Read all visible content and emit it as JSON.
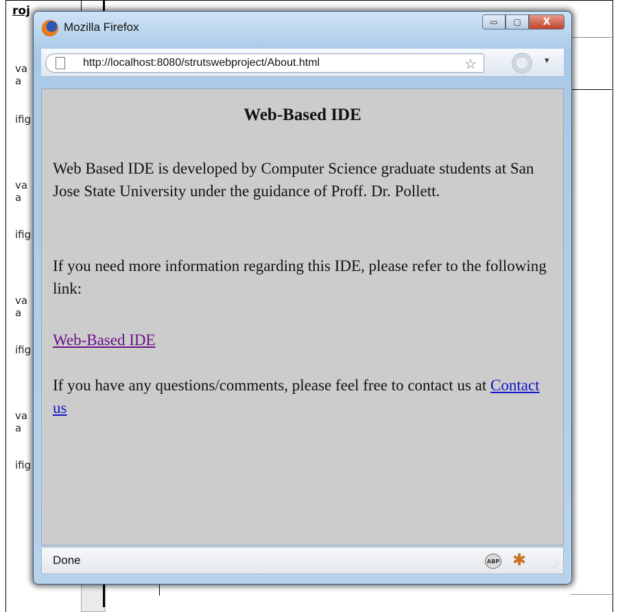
{
  "background": {
    "title": "roj",
    "fragments": [
      "va",
      "a",
      "ifig",
      "va",
      "a",
      "ifig",
      "va",
      "a",
      "ifig",
      "va",
      "a",
      "ifig"
    ]
  },
  "window": {
    "title": "Mozilla Firefox",
    "controls": {
      "minimize": "▭",
      "maximize": "▢",
      "close": "X"
    },
    "url": "http://localhost:8080/strutswebproject/About.html",
    "status": "Done",
    "abp_label": "ABP"
  },
  "page": {
    "heading": "Web-Based IDE",
    "para1": "Web Based IDE is developed by Computer Science graduate students at San Jose State University under the guidance of Proff. Dr. Pollett.",
    "para2": "If you need more information regarding this IDE, please refer to the following link:",
    "link1": "Web-Based IDE",
    "para3_prefix": "If you have any questions/comments, please feel free to contact us at ",
    "link2": "Contact us"
  },
  "icons": {
    "logo": "firefox-logo-icon",
    "page": "page-icon",
    "bookmark": "star-icon",
    "go": "go-button-icon",
    "dropdown": "chevron-down-icon",
    "abp": "adblock-icon",
    "firebug": "firebug-icon",
    "grip": "resize-grip-icon"
  },
  "colors": {
    "content_bg": "#cccccc",
    "visited_link": "#6a0f89",
    "link": "#1111cc"
  }
}
